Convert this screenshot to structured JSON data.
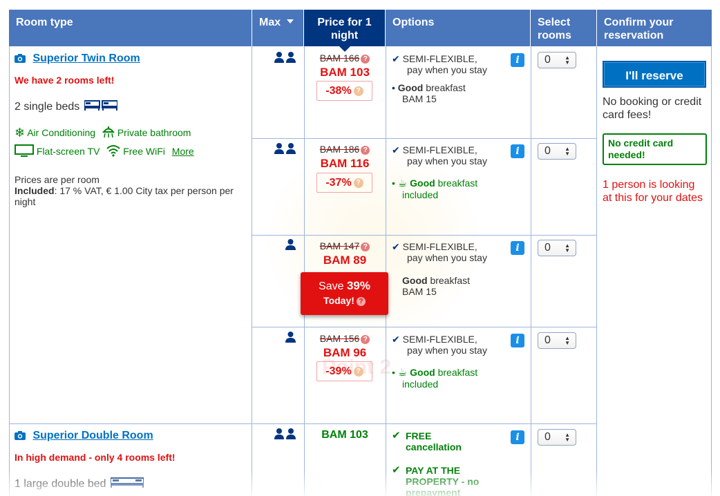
{
  "header": {
    "room_type": "Room type",
    "max": "Max",
    "price": "Price for 1 night",
    "options": "Options",
    "select_rooms": "Select rooms",
    "confirm": "Confirm your reservation"
  },
  "rooms": [
    {
      "name": "Superior Twin Room",
      "urgency": "We have 2 rooms left!",
      "beds": "2 single beds",
      "facilities": {
        "ac": "Air Conditioning",
        "bath": "Private bathroom",
        "tv": "Flat-screen TV",
        "wifi": "Free WiFi",
        "more": "More"
      },
      "prices_note": "Prices are per room",
      "included_label": "Included",
      "included_text": ": 17 % VAT, € 1.00 City tax per person per night"
    },
    {
      "name": "Superior Double Room",
      "urgency": "In high demand - only 4 rooms left!",
      "beds": "1 large double bed"
    }
  ],
  "offers": [
    {
      "max_guests": 2,
      "old_price": "BAM 166",
      "new_price": "BAM 103",
      "discount": "-38%",
      "policy": "SEMI-FLEXIBLE,",
      "policy_sub": "pay when you stay",
      "meal_bold": "Good",
      "meal_rest": "breakfast",
      "meal_sub": "BAM 15",
      "select_value": "0"
    },
    {
      "max_guests": 2,
      "old_price": "BAM 186",
      "new_price": "BAM 116",
      "discount": "-37%",
      "policy": "SEMI-FLEXIBLE,",
      "policy_sub": "pay when you stay",
      "meal_bold": "Good",
      "meal_rest": "breakfast",
      "meal_sub": "included",
      "select_value": "0"
    },
    {
      "max_guests": 1,
      "old_price": "BAM 147",
      "new_price": "BAM 89",
      "save_label": "Save",
      "save_pct": "39%",
      "save_today": "Today!",
      "policy": "SEMI-FLEXIBLE,",
      "policy_sub": "pay when you stay",
      "meal_bold": "Good",
      "meal_rest": "breakfast",
      "meal_sub": "BAM 15",
      "select_value": "0"
    },
    {
      "max_guests": 1,
      "old_price": "BAM 156",
      "new_price": "BAM 96",
      "discount": "-39%",
      "policy": "SEMI-FLEXIBLE,",
      "policy_sub": "pay when you stay",
      "meal_bold": "Good",
      "meal_rest": "breakfast",
      "meal_sub": "included",
      "select_value": "0"
    },
    {
      "max_guests": 2,
      "price": "BAM 103",
      "cancel": "FREE cancellation",
      "payment": "PAY AT THE PROPERTY - no prepayment",
      "select_value": "0"
    }
  ],
  "sidebar": {
    "reserve_button": "I'll reserve",
    "no_fees": "No booking or credit card fees!",
    "no_credit_card": "No credit card needed!",
    "looking": "1 person is looking at this for your dates"
  },
  "watermark_text": "Point 2",
  "colors": {
    "header_bg": "#4a76bc",
    "header_price_bg": "#003580",
    "link_blue": "#0071c2",
    "urgent_red": "#e21111",
    "green": "#008009"
  }
}
